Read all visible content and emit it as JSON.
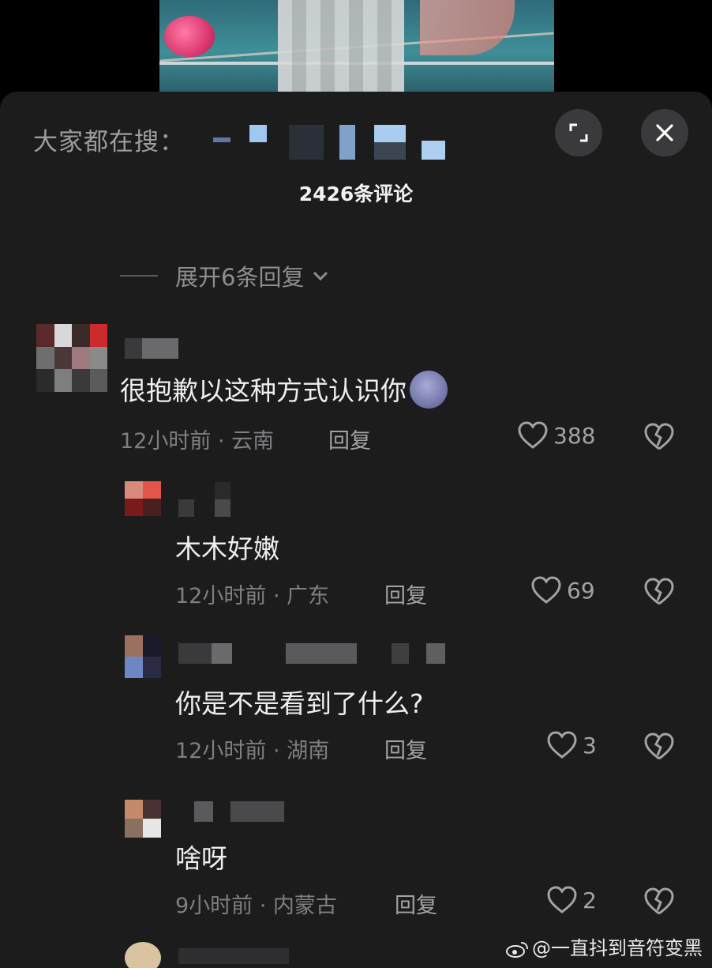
{
  "header": {
    "search_prefix": "大家都在搜：",
    "comment_count": "2426条评论",
    "expand_replies": "展开6条回复"
  },
  "comments": [
    {
      "text": "很抱歉以这种方式认识你",
      "emoji": "moon-face-emoji",
      "time": "12小时前 · 云南",
      "reply": "回复",
      "likes": "388"
    },
    {
      "text": "木木好嫩",
      "time": "12小时前 · 广东",
      "reply": "回复",
      "likes": "69"
    },
    {
      "text": "你是不是看到了什么?",
      "time": "12小时前 · 湖南",
      "reply": "回复",
      "likes": "3"
    },
    {
      "text": "啥呀",
      "time": "9小时前 · 内蒙古",
      "reply": "回复",
      "likes": "2"
    }
  ],
  "watermark": "@一直抖到音符变黑",
  "icons": {
    "expand": "fullscreen-icon",
    "close": "close-icon",
    "like": "heart-outline-icon",
    "dislike": "broken-heart-icon",
    "chevron": "chevron-down-icon",
    "weibo": "weibo-logo-icon"
  }
}
